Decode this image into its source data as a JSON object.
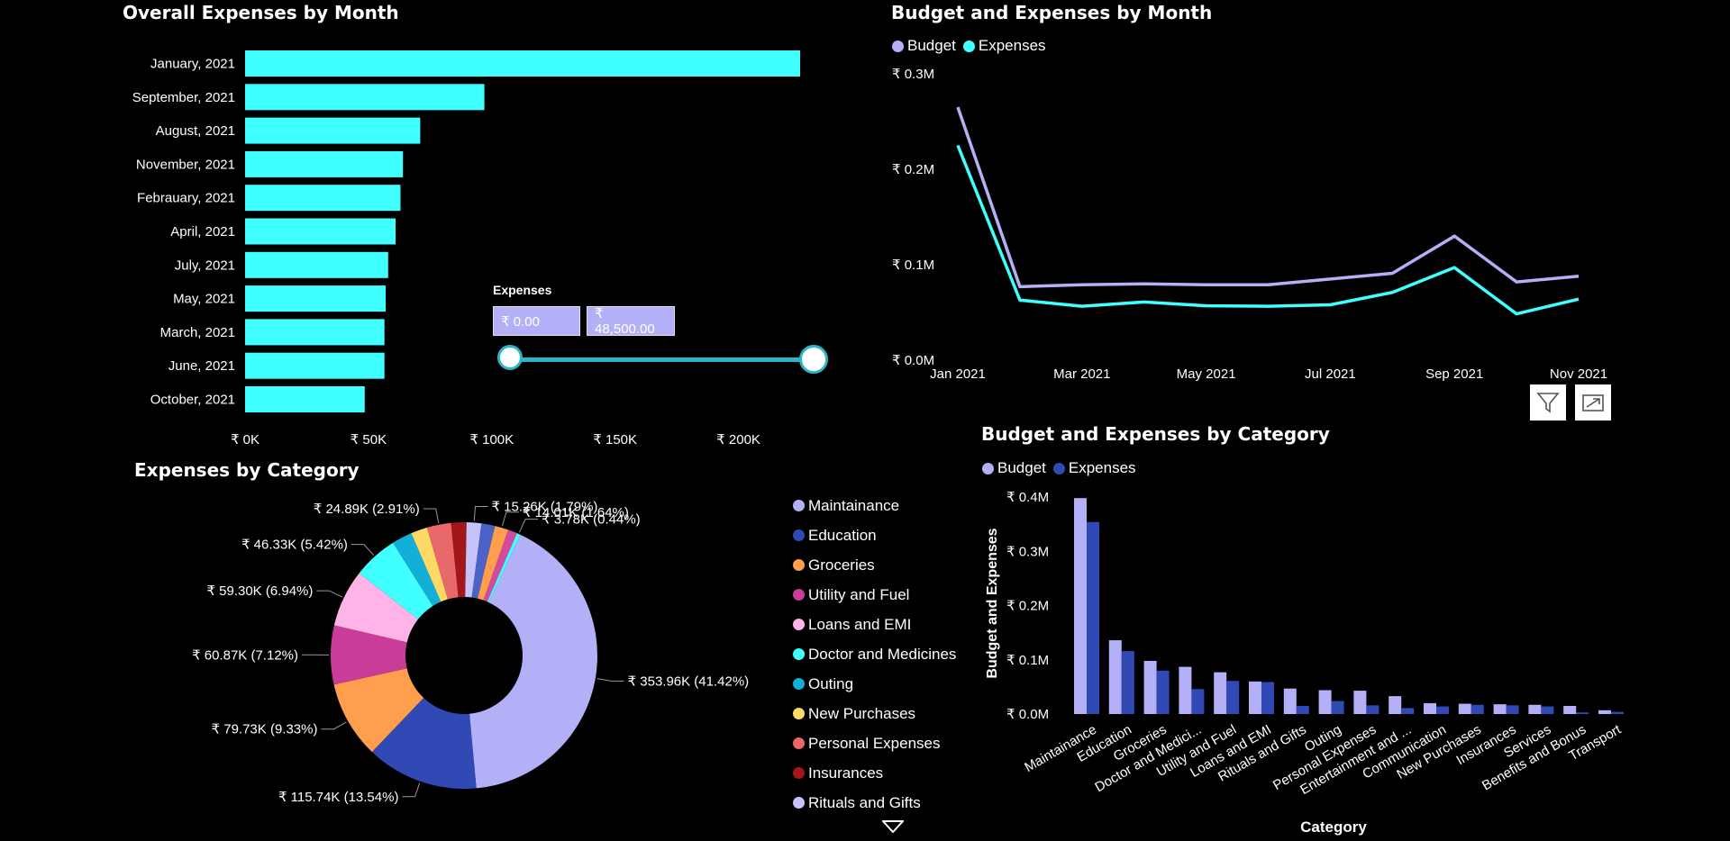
{
  "colors": {
    "cyan": "#40ffff",
    "budget": "#b3b0f8",
    "expenses_dark": "#3049b5",
    "slider_track": "#2bb5c8"
  },
  "slider": {
    "label": "Expenses",
    "min_text": "₹ 0.00",
    "max_text": "₹ 48,500.00"
  },
  "icons": [
    "filter-icon",
    "focus-mode-icon",
    "chevron-down-icon"
  ],
  "chart_data": [
    {
      "type": "bar",
      "orientation": "horizontal",
      "title": "Overall Expenses by Month",
      "categories": [
        "January, 2021",
        "September, 2021",
        "August, 2021",
        "November, 2021",
        "Febrauary, 2021",
        "April, 2021",
        "July, 2021",
        "May, 2021",
        "March, 2021",
        "June, 2021",
        "October, 2021"
      ],
      "values": [
        225000,
        97000,
        71000,
        64000,
        63000,
        61000,
        58000,
        57000,
        56500,
        56500,
        48500
      ],
      "xticks": [
        "₹ 0K",
        "₹ 50K",
        "₹ 100K",
        "₹ 150K",
        "₹ 200K"
      ],
      "xlim": [
        0,
        225000
      ],
      "color": "#40ffff"
    },
    {
      "type": "line",
      "title": "Budget and Expenses by Month",
      "x": [
        "2021-01",
        "2021-02",
        "2021-03",
        "2021-04",
        "2021-05",
        "2021-06",
        "2021-07",
        "2021-08",
        "2021-09",
        "2021-10",
        "2021-11"
      ],
      "xticks": [
        "Jan 2021",
        "Mar 2021",
        "May 2021",
        "Jul 2021",
        "Sep 2021",
        "Nov 2021"
      ],
      "yticks": [
        "₹ 0.3M",
        "₹ 0.2M",
        "₹ 0.1M",
        "₹ 0.0M"
      ],
      "ylim": [
        0,
        300000
      ],
      "legend_position": "top-left",
      "series": [
        {
          "name": "Budget",
          "color": "#b3b0f8",
          "values": [
            265000,
            77000,
            79000,
            80000,
            79000,
            79000,
            85000,
            91000,
            130000,
            82000,
            88000
          ]
        },
        {
          "name": "Expenses",
          "color": "#40ffff",
          "values": [
            225000,
            63000,
            56500,
            61000,
            57000,
            56500,
            58000,
            71000,
            97000,
            48500,
            64000
          ]
        }
      ]
    },
    {
      "type": "pie",
      "title": "Expenses by Category",
      "donut": true,
      "slices": [
        {
          "name": "Maintainance",
          "value": 353.96,
          "color": "#b3b0f8",
          "label": "₹ 353.96K (41.42%)"
        },
        {
          "name": "Education",
          "value": 115.74,
          "color": "#3049b5",
          "label": "₹ 115.74K (13.54%)"
        },
        {
          "name": "Groceries",
          "value": 79.73,
          "color": "#ff9e4d",
          "label": "₹ 79.73K (9.33%)"
        },
        {
          "name": "Utility and Fuel",
          "value": 60.87,
          "color": "#c93c98",
          "label": "₹ 60.87K (7.12%)"
        },
        {
          "name": "Loans and EMI",
          "value": 59.3,
          "color": "#ffb3e6",
          "label": "₹ 59.30K (6.94%)"
        },
        {
          "name": "Doctor and Medicines",
          "value": 46.33,
          "color": "#40ffff",
          "label": "₹ 46.33K (5.42%)"
        },
        {
          "name": "Outing",
          "value": 21.0,
          "color": "#12b0d8",
          "label": ""
        },
        {
          "name": "New Purchases",
          "value": 17.0,
          "color": "#ffd966",
          "label": ""
        },
        {
          "name": "Personal Expenses",
          "value": 24.89,
          "color": "#e9686a",
          "label": "₹ 24.89K (2.91%)"
        },
        {
          "name": "Insurances",
          "value": 15.8,
          "color": "#a3171a",
          "label": ""
        },
        {
          "name": "Rituals and Gifts",
          "value": 15.26,
          "color": "#c6c3fa",
          "label": "₹ 15.26K (1.79%)"
        },
        {
          "name": "Entertainment",
          "value": 14.0,
          "color": "#4b63c7",
          "label": ""
        },
        {
          "name": "Communication",
          "value": 14.01,
          "color": "#ff9e4d",
          "label": "₹ 14.01K (1.64%)"
        },
        {
          "name": "Services",
          "value": 9.5,
          "color": "#d44a9e",
          "label": ""
        },
        {
          "name": "Transport",
          "value": 3.78,
          "color": "#40ffff",
          "label": "₹ 3.78K (0.44%)"
        }
      ],
      "legend": [
        {
          "name": "Maintainance",
          "color": "#b3b0f8"
        },
        {
          "name": "Education",
          "color": "#3049b5"
        },
        {
          "name": "Groceries",
          "color": "#ff9e4d"
        },
        {
          "name": "Utility and Fuel",
          "color": "#c93c98"
        },
        {
          "name": "Loans and EMI",
          "color": "#ffb3e6"
        },
        {
          "name": "Doctor and Medicines",
          "color": "#40ffff"
        },
        {
          "name": "Outing",
          "color": "#12b0d8"
        },
        {
          "name": "New Purchases",
          "color": "#ffd966"
        },
        {
          "name": "Personal Expenses",
          "color": "#e9686a"
        },
        {
          "name": "Insurances",
          "color": "#a3171a"
        },
        {
          "name": "Rituals and Gifts",
          "color": "#c6c3fa"
        }
      ]
    },
    {
      "type": "bar",
      "title": "Budget and Expenses by Category",
      "xlabel": "Category",
      "ylabel": "Budget and Expenses",
      "ylim": [
        0,
        400000
      ],
      "yticks": [
        "₹ 0.4M",
        "₹ 0.3M",
        "₹ 0.2M",
        "₹ 0.1M",
        "₹ 0.0M"
      ],
      "legend_position": "top-left",
      "categories": [
        "Maintainance",
        "Education",
        "Groceries",
        "Doctor and Medici...",
        "Utility and Fuel",
        "Loans and EMI",
        "Rituals and Gifts",
        "Outing",
        "Personal Expenses",
        "Entertainment and ...",
        "Communication",
        "New Purchases",
        "Insurances",
        "Services",
        "Benefits and Bonus",
        "Transport"
      ],
      "series": [
        {
          "name": "Budget",
          "color": "#b3b0f8",
          "values": [
            398000,
            136000,
            98000,
            87000,
            77000,
            60000,
            47000,
            44000,
            43000,
            33000,
            20000,
            19000,
            18000,
            17000,
            15000,
            7000
          ]
        },
        {
          "name": "Expenses",
          "color": "#3049b5",
          "values": [
            354000,
            116000,
            80000,
            46000,
            61000,
            59000,
            15000,
            24000,
            16000,
            11000,
            14000,
            17000,
            16000,
            14000,
            3000,
            4000
          ]
        }
      ]
    }
  ]
}
